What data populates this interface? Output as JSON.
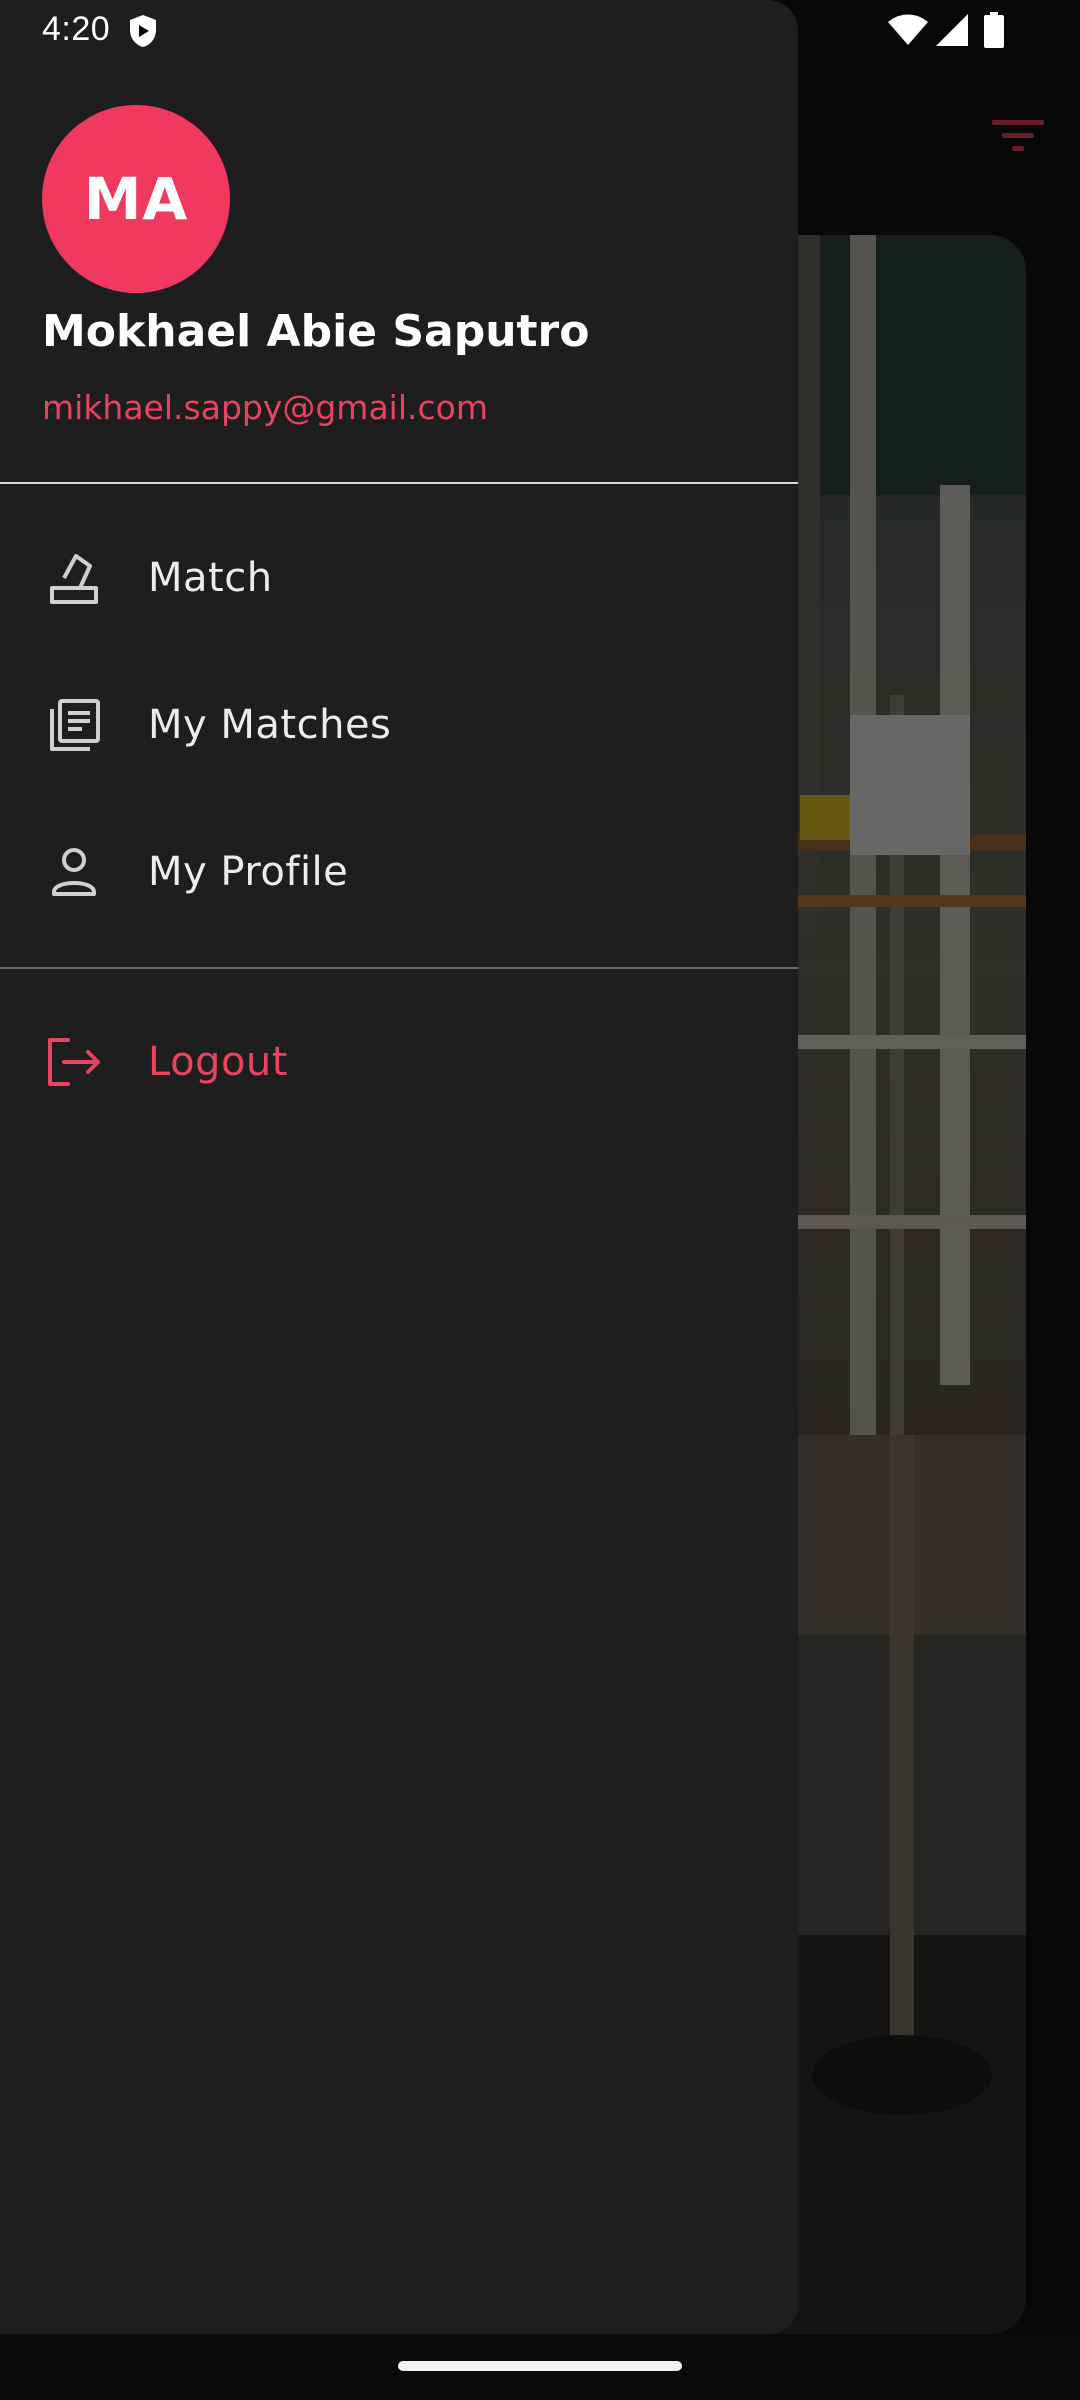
{
  "status_bar": {
    "time": "4:20",
    "icons": [
      "shield-icon",
      "wifi-icon",
      "signal-icon",
      "battery-icon"
    ]
  },
  "background": {
    "filter_icon": "filter-icon",
    "accent_color": "#e8435f"
  },
  "drawer": {
    "profile": {
      "initials": "MA",
      "name": "Mokhael Abie Saputro",
      "email": "mikhael.sappy@gmail.com",
      "avatar_color": "#f0395f"
    },
    "menu": [
      {
        "label": "Match",
        "icon": "match-icon"
      },
      {
        "label": "My Matches",
        "icon": "list-icon"
      },
      {
        "label": "My Profile",
        "icon": "person-icon"
      }
    ],
    "logout": {
      "label": "Logout",
      "icon": "logout-icon",
      "color": "#e8435f"
    }
  }
}
